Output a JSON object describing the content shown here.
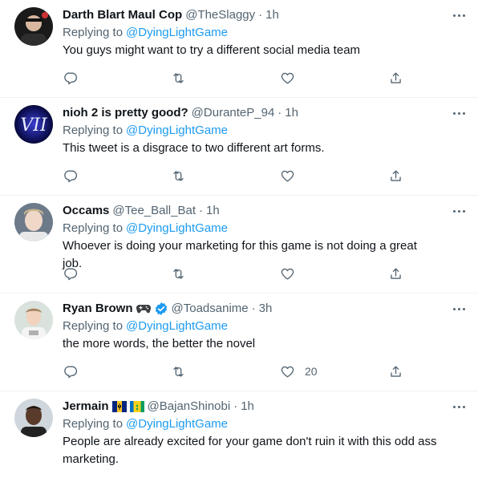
{
  "tweets": [
    {
      "name": "Darth Blart Maul Cop",
      "handle": "@TheSlaggy",
      "separator": "·",
      "time": "1h",
      "replying_label": "Replying to",
      "replying_to": "@DyingLightGame",
      "text": "You guys might want to try a different social media team",
      "like_count": ""
    },
    {
      "name": "nioh 2 is pretty good?",
      "handle": "@DuranteP_94",
      "separator": "·",
      "time": "1h",
      "replying_label": "Replying to",
      "replying_to": "@DyingLightGame",
      "text": "This tweet is a disgrace to two different art forms.",
      "avatar_text": "VII",
      "like_count": ""
    },
    {
      "name": "Occams",
      "handle": "@Tee_Ball_Bat",
      "separator": "·",
      "time": "1h",
      "replying_label": "Replying to",
      "replying_to": "@DyingLightGame",
      "text": "Whoever is doing your marketing for this game is not doing a great job.",
      "like_count": ""
    },
    {
      "name": "Ryan Brown",
      "handle": "@Toadsanime",
      "separator": "·",
      "time": "3h",
      "replying_label": "Replying to",
      "replying_to": "@DyingLightGame",
      "text": "the more words, the better the novel",
      "like_count": "20",
      "badges": [
        "gamepad-emoji",
        "verified-badge"
      ]
    },
    {
      "name": "Jermain",
      "handle": "@BajanShinobi",
      "separator": "·",
      "time": "1h",
      "replying_label": "Replying to",
      "replying_to": "@DyingLightGame",
      "text_line1": "People are already excited for your game don't ruin it with this odd ass",
      "text_line2": "marketing.",
      "like_count": "",
      "badges": [
        "barbados-flag",
        "st-vincent-flag"
      ]
    }
  ],
  "icons": {
    "reply": "reply-icon",
    "retweet": "retweet-icon",
    "like": "heart-icon",
    "share": "share-icon",
    "more": "more-options-icon"
  },
  "colors": {
    "accent": "#1d9bf0",
    "secondary_text": "#536471",
    "primary_text": "#0f1419",
    "divider": "#eff3f4"
  }
}
